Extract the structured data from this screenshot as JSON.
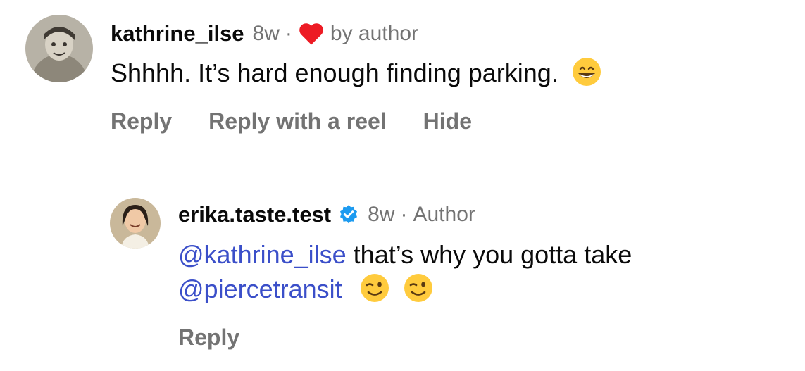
{
  "comment": {
    "username": "kathrine_ilse",
    "time": "8w",
    "separator": "·",
    "liked_label": "by author",
    "text": "Shhhh.  It’s hard enough finding parking.",
    "emoji": "grinning-face",
    "actions": {
      "reply": "Reply",
      "reply_reel": "Reply with a reel",
      "hide": "Hide"
    }
  },
  "reply": {
    "username": "erika.taste.test",
    "verified": true,
    "time": "8w",
    "separator": "·",
    "author_label": "Author",
    "mention_1": "@kathrine_ilse",
    "text_1": " that’s why you gotta take",
    "mention_2": "@piercetransit",
    "emojis": [
      "winking-face",
      "winking-face"
    ],
    "actions": {
      "reply": "Reply"
    }
  },
  "colors": {
    "muted": "#737373",
    "mention": "#3b4fc9",
    "heart": "#ed1b24",
    "verified": "#1d9bf0"
  }
}
